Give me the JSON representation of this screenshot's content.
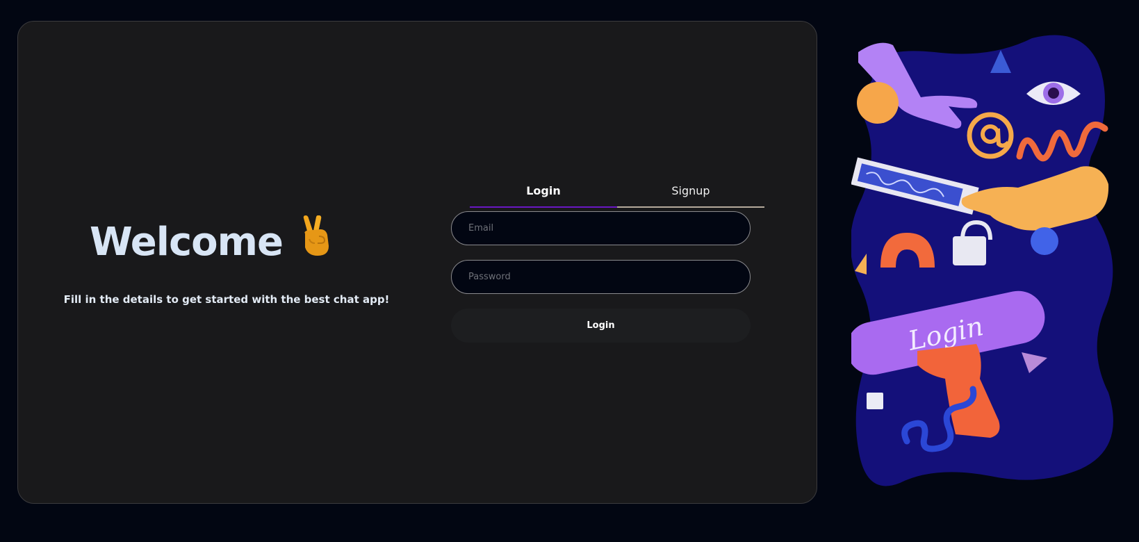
{
  "welcome": {
    "title": "Welcome",
    "subtitle": "Fill in the details to get started with the best chat app!",
    "emoji": "victory-hand"
  },
  "auth": {
    "tabs": [
      {
        "label": "Login",
        "active": true
      },
      {
        "label": "Signup",
        "active": false
      }
    ],
    "email": {
      "placeholder": "Email",
      "value": ""
    },
    "password": {
      "placeholder": "Password",
      "value": ""
    },
    "submit_label": "Login"
  },
  "illustration": {
    "button_text": "Login"
  },
  "colors": {
    "background": "#020612",
    "card": "#19191b",
    "accent": "#6a17c4",
    "text_light": "#d8e5f5",
    "illustration_bg": "#14107a"
  }
}
